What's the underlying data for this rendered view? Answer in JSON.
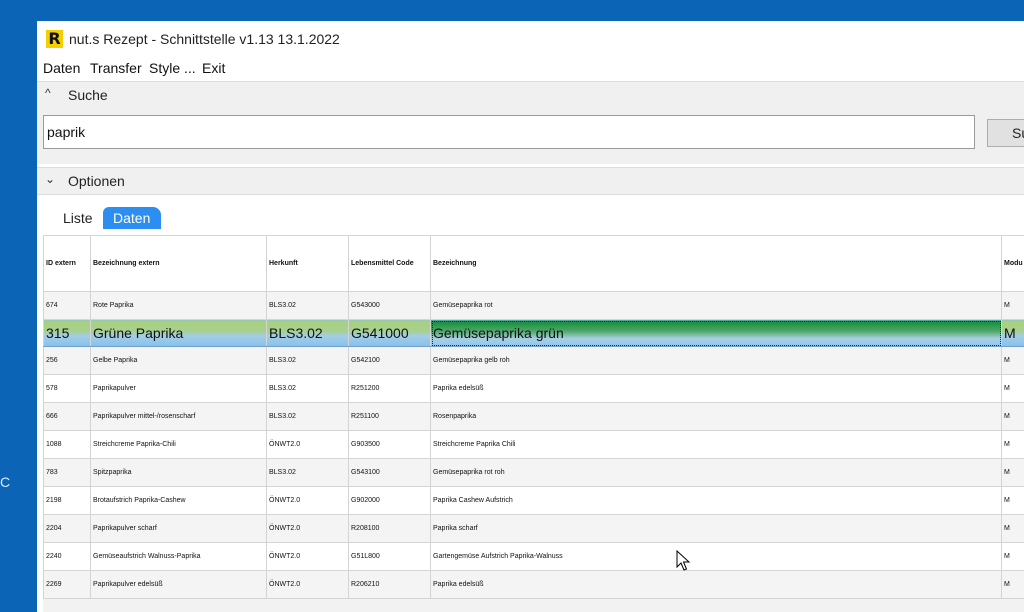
{
  "desktop": {
    "edge_char": "C"
  },
  "window": {
    "logo_letter": "R",
    "title": "nut.s Rezept - Schnittstelle v1.13 13.1.2022"
  },
  "menu": [
    "Daten",
    "Transfer",
    "Style ...",
    "Exit"
  ],
  "search_section": {
    "label": "Suche",
    "chevron": "^",
    "query": "paprik",
    "button_label": "Su"
  },
  "options_section": {
    "label": "Optionen",
    "chevron": "⌄"
  },
  "tabs": {
    "liste": "Liste",
    "daten": "Daten",
    "active": "Daten"
  },
  "table": {
    "headers": {
      "id": "ID extern",
      "bez_ext": "Bezeichnung extern",
      "herkunft": "Herkunft",
      "code": "Lebensmittel Code",
      "bezeichnung": "Bezeichnung",
      "modul": "Modu"
    },
    "rows": [
      {
        "id": "674",
        "bez_ext": "Rote Paprika",
        "herkunft": "BLS3.02",
        "code": "G543000",
        "bezeichnung": "Gemüsepaprika rot",
        "modul": "M"
      },
      {
        "id": "315",
        "bez_ext": "Grüne Paprika",
        "herkunft": "BLS3.02",
        "code": "G541000",
        "bezeichnung": "Gemüsepaprika grün",
        "modul": "M"
      },
      {
        "id": "256",
        "bez_ext": "Gelbe Paprika",
        "herkunft": "BLS3.02",
        "code": "G542100",
        "bezeichnung": "Gemüsepaprika gelb roh",
        "modul": "M"
      },
      {
        "id": "578",
        "bez_ext": "Paprikapulver",
        "herkunft": "BLS3.02",
        "code": "R251200",
        "bezeichnung": "Paprika edelsüß",
        "modul": "M"
      },
      {
        "id": "666",
        "bez_ext": "Paprikapulver mittel-/rosenscharf",
        "herkunft": "BLS3.02",
        "code": "R251100",
        "bezeichnung": "Rosenpaprika",
        "modul": "M"
      },
      {
        "id": "1088",
        "bez_ext": "Streichcreme Paprika-Chili",
        "herkunft": "ÖNWT2.0",
        "code": "G903500",
        "bezeichnung": "Streichcreme Paprika Chili",
        "modul": "M"
      },
      {
        "id": "783",
        "bez_ext": "Spitzpaprika",
        "herkunft": "BLS3.02",
        "code": "G543100",
        "bezeichnung": "Gemüsepaprika rot roh",
        "modul": "M"
      },
      {
        "id": "2198",
        "bez_ext": "Brotaufstrich Paprika-Cashew",
        "herkunft": "ÖNWT2.0",
        "code": "G902000",
        "bezeichnung": "Paprika Cashew Aufstrich",
        "modul": "M"
      },
      {
        "id": "2204",
        "bez_ext": "Paprikapulver scharf",
        "herkunft": "ÖNWT2.0",
        "code": "R208100",
        "bezeichnung": "Paprika scharf",
        "modul": "M"
      },
      {
        "id": "2240",
        "bez_ext": "Gemüseaufstrich Walnuss-Paprika",
        "herkunft": "ÖNWT2.0",
        "code": "G51L800",
        "bezeichnung": "Gartengemüse Aufstrich Paprika-Walnuss",
        "modul": "M"
      },
      {
        "id": "2269",
        "bez_ext": "Paprikapulver edelsüß",
        "herkunft": "ÖNWT2.0",
        "code": "R206210",
        "bezeichnung": "Paprika edelsüß",
        "modul": "M"
      }
    ]
  },
  "colors": {
    "desktop": "#0b64b6",
    "tab_active": "#2b8ef0",
    "logo": "#f5d000"
  }
}
